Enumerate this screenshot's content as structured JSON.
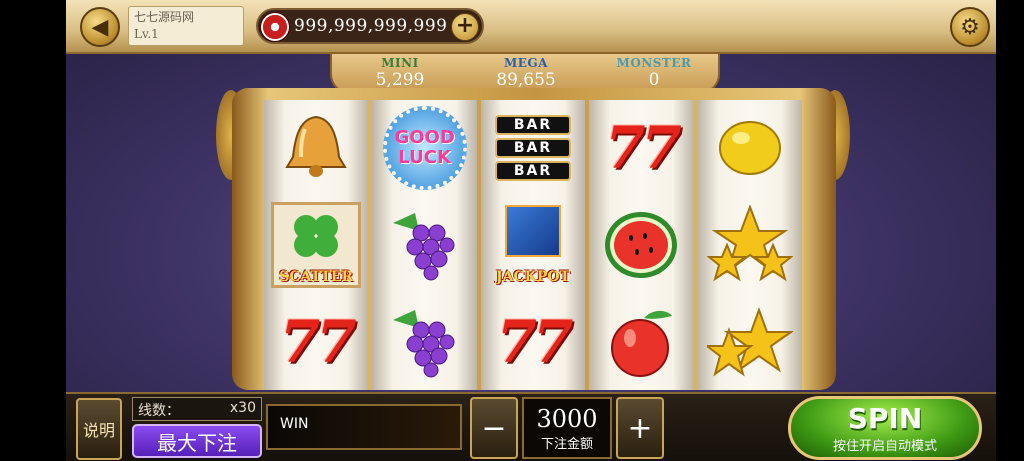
{
  "header": {
    "account_name": "七七源码网",
    "account_level": "Lv.1",
    "balance": "999,999,999,999",
    "back_icon": "back-arrow-icon",
    "settings_icon": "gear-icon"
  },
  "jackpots": [
    {
      "name": "MINI",
      "value": "5,299"
    },
    {
      "name": "MEGA",
      "value": "89,655"
    },
    {
      "name": "MONSTER",
      "value": "0"
    }
  ],
  "reels": [
    [
      "bell",
      "scatter",
      "seven"
    ],
    [
      "good-luck",
      "grapes",
      "grapes"
    ],
    [
      "bar-triple",
      "jackpot",
      "seven"
    ],
    [
      "seven",
      "watermelon",
      "apple"
    ],
    [
      "lemon",
      "stars",
      "stars"
    ]
  ],
  "symbols": {
    "seven_text": "77",
    "bar_text": "BAR",
    "good_luck_line1": "GOOD",
    "good_luck_line2": "LUCK",
    "scatter_caption": "SCATTER",
    "jackpot_caption": "JACKPOT"
  },
  "controls": {
    "help_label": "说明",
    "lines_label": "线数：",
    "lines_value": "x30",
    "max_bet_label": "最大下注",
    "win_label": "WIN",
    "minus_label": "−",
    "plus_label": "+",
    "bet_value": "3000",
    "bet_label": "下注金额",
    "spin_label": "SPIN",
    "spin_sub": "按住开启自动模式"
  }
}
